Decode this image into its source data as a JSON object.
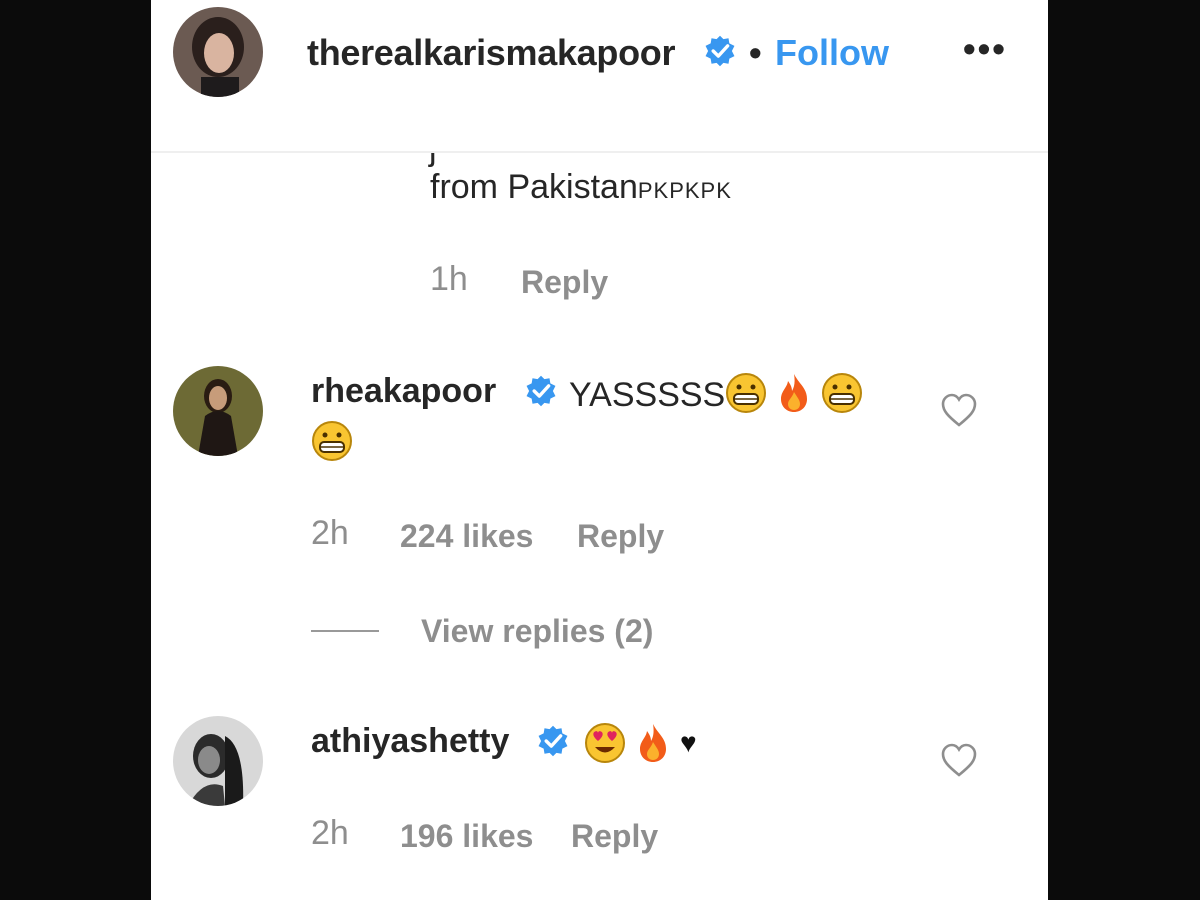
{
  "header": {
    "username": "therealkarismakapoor",
    "verified_icon": "verified-badge-icon",
    "separator": "•",
    "follow_label": "Follow",
    "more_label": "•••",
    "colors": {
      "follow": "#3897f0",
      "verified": "#3897f0"
    }
  },
  "previous_comment": {
    "text": "from Pakistan",
    "flags": "PKPKPK",
    "time": "1h",
    "reply_label": "Reply"
  },
  "comments": [
    {
      "username": "rheakapoor",
      "text": "YASSSSS",
      "emoji": [
        "grinning-face-icon",
        "fire-icon",
        "grinning-face-icon",
        "grinning-face-icon"
      ],
      "time": "2h",
      "likes": "224 likes",
      "reply_label": "Reply",
      "view_replies": "View replies (2)"
    },
    {
      "username": "athiyashetty",
      "text": "",
      "emoji": [
        "heart-eyes-face-icon",
        "fire-icon"
      ],
      "trailing_symbol": "♥",
      "time": "2h",
      "likes": "196 likes",
      "reply_label": "Reply"
    }
  ]
}
